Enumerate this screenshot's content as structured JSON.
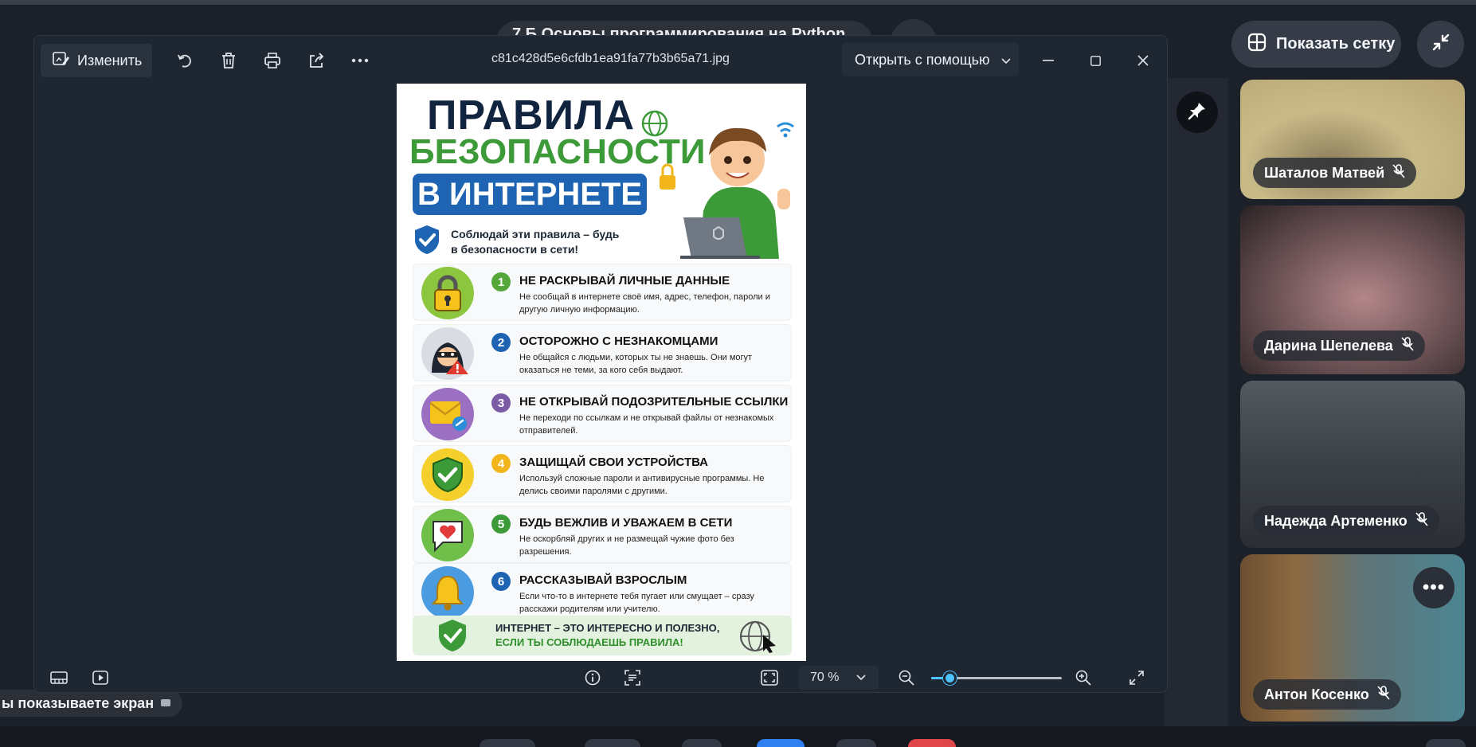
{
  "meeting": {
    "title": "7 Б Основы программирования на Python",
    "grid_button_label": "Показать сетку",
    "share_notice": "ы показываете экран"
  },
  "participants": [
    {
      "name": "Шаталов Матвей",
      "muted": true
    },
    {
      "name": "Дарина Шепелева",
      "muted": true
    },
    {
      "name": "Надежда Артеменко",
      "muted": true
    },
    {
      "name": "Антон Косенко",
      "muted": true
    }
  ],
  "viewer": {
    "edit_label": "Изменить",
    "filename": "c81c428d5e6cfdb1ea91fa77b3b65a71.jpg",
    "open_with_label": "Открыть с помощью",
    "zoom_label": "70 %",
    "zoom_level": 0.14,
    "toolbar_icons": [
      "rotate-icon",
      "delete-icon",
      "print-icon",
      "share-icon",
      "more-icon"
    ]
  },
  "poster": {
    "title_line1": "ПРАВИЛА",
    "title_line2": "БЕЗОПАСНОСТИ",
    "title_line3": "В ИНТЕРНЕТЕ",
    "subtitle": "Соблюдай эти правила – будь в безопасности в сети!",
    "rules": [
      {
        "num": "1",
        "title": "НЕ РАСКРЫВАЙ ЛИЧНЫЕ ДАННЫЕ",
        "desc": "Не сообщай в интернете своё имя, адрес, телефон, пароли и другую личную информацию.",
        "color": "#55a73a",
        "icon_bg": "#8cc63f"
      },
      {
        "num": "2",
        "title": "ОСТОРОЖНО С НЕЗНАКОМЦАМИ",
        "desc": "Не общайся с людьми, которых ты не знаешь. Они могут оказаться не теми, за кого себя выдают.",
        "color": "#1f64b3",
        "icon_bg": "#d9dde3"
      },
      {
        "num": "3",
        "title": "НЕ ОТКРЫВАЙ ПОДОЗРИТЕЛЬНЫЕ ССЫЛКИ",
        "desc": "Не переходи по ссылкам и не открывай файлы от незнакомых отправителей.",
        "color": "#7b5aa6",
        "icon_bg": "#9b6fc2"
      },
      {
        "num": "4",
        "title": "ЗАЩИЩАЙ СВОИ УСТРОЙСТВА",
        "desc": "Используй сложные пароли и антивирусные программы. Не делись своими паролями с другими.",
        "color": "#f2b61c",
        "icon_bg": "#f5cf2b"
      },
      {
        "num": "5",
        "title": "БУДЬ ВЕЖЛИВ И УВАЖАЕМ В СЕТИ",
        "desc": "Не оскорбляй других и не размещай чужие фото без разрешения.",
        "color": "#3d9a38",
        "icon_bg": "#6fbf4a"
      },
      {
        "num": "6",
        "title": "РАССКАЗЫВАЙ ВЗРОСЛЫМ",
        "desc": "Если что-то в интернете тебя пугает или смущает – сразу расскажи родителям или учителю.",
        "color": "#1f64b3",
        "icon_bg": "#4a9be0"
      }
    ],
    "footer_line1": "ИНТЕРНЕТ – ЭТО ИНТЕРЕСНО И ПОЛЕЗНО,",
    "footer_line2": "ЕСЛИ ТЫ СОБЛЮДАЕШЬ ПРАВИЛА!"
  },
  "colors": {
    "accent": "#4cc2ff",
    "title_dark": "#10233f",
    "title_green": "#3d9a38",
    "title_blue": "#1f64b3"
  }
}
